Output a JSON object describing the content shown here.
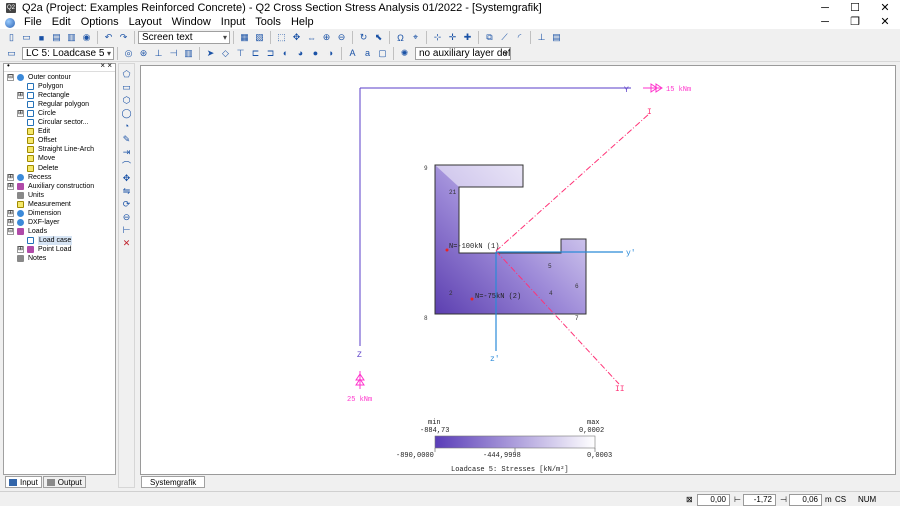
{
  "window": {
    "app_icon": "Q2",
    "title": "Q2a (Project: Examples Reinforced Concrete) - Q2 Cross Section Stress Analysis 01/2022 - [Systemgrafik]",
    "min_icon": "─",
    "max_icon": "☐",
    "close_icon": "✕"
  },
  "menu": {
    "items": [
      "File",
      "Edit",
      "Options",
      "Layout",
      "Window",
      "Input",
      "Tools",
      "Help"
    ],
    "right_min": "─",
    "right_restore": "❐",
    "right_close": "✕"
  },
  "toolbar": {
    "text_mode_value": "Screen text",
    "loadcase_value": "LC 5: Loadcase 5",
    "aux_layer_value": "no auxiliary layer defines"
  },
  "tree": {
    "header_left": "•",
    "header_right": "× ×",
    "items": [
      {
        "label": "Outer contour",
        "level": 0,
        "exp": "⊟",
        "icon": "bl"
      },
      {
        "label": "Polygon",
        "level": 1,
        "exp": "",
        "icon": "sq"
      },
      {
        "label": "Rectangle",
        "level": 1,
        "exp": "⊞",
        "icon": "sq"
      },
      {
        "label": "Regular polygon",
        "level": 1,
        "exp": "",
        "icon": "sq"
      },
      {
        "label": "Circle",
        "level": 1,
        "exp": "⊞",
        "icon": "sq"
      },
      {
        "label": "Circular sector...",
        "level": 1,
        "exp": "",
        "icon": "sq"
      },
      {
        "label": "Edit",
        "level": 1,
        "exp": "",
        "icon": "yl"
      },
      {
        "label": "Offset",
        "level": 1,
        "exp": "",
        "icon": "yl"
      },
      {
        "label": "Straight Line-Arch",
        "level": 1,
        "exp": "",
        "icon": "yl"
      },
      {
        "label": "Move",
        "level": 1,
        "exp": "",
        "icon": "yl"
      },
      {
        "label": "Delete",
        "level": 1,
        "exp": "",
        "icon": "yl"
      },
      {
        "label": "Recess",
        "level": 0,
        "exp": "⊞",
        "icon": "bl"
      },
      {
        "label": "Auxiliary construction",
        "level": 0,
        "exp": "⊞",
        "icon": "mg"
      },
      {
        "label": "Units",
        "level": 0,
        "exp": "",
        "icon": "gr"
      },
      {
        "label": "Measurement",
        "level": 0,
        "exp": "",
        "icon": "yl"
      },
      {
        "label": "Dimension",
        "level": 0,
        "exp": "⊞",
        "icon": "bl"
      },
      {
        "label": "DXF-layer",
        "level": 0,
        "exp": "⊞",
        "icon": "bl"
      },
      {
        "label": "Loads",
        "level": 0,
        "exp": "⊟",
        "icon": "mg"
      },
      {
        "label": "Load case",
        "level": 1,
        "exp": "",
        "icon": "sq",
        "selected": true
      },
      {
        "label": "Point Load",
        "level": 1,
        "exp": "⊞",
        "icon": "mg"
      },
      {
        "label": "Notes",
        "level": 0,
        "exp": "",
        "icon": "gr"
      }
    ]
  },
  "bottom_tabs": {
    "input": "Input",
    "output": "Output",
    "graphic": "Systemgrafik"
  },
  "status": {
    "field1": "0,00",
    "field2": "-1,72",
    "field3": "0,06",
    "unit": "m",
    "cs": "CS",
    "num": "NUM"
  },
  "graphic": {
    "axis_y": "Y",
    "axis_z": "Z",
    "axis_y2": "y'",
    "axis_z2": "z'",
    "axis_I": "I",
    "axis_II": "II",
    "moment_y": "15 kNm",
    "moment_z": "25 kNm",
    "load_1": "N=-100kN (1)",
    "load_2": "N=-75kN (2)",
    "nodes": [
      "9",
      "21",
      "8",
      "2",
      "4",
      "5",
      "6",
      "7"
    ],
    "legend_min_label": "min",
    "legend_max_label": "max",
    "legend_min_value": "-884,73",
    "legend_max_value": "0,0002",
    "legend_tick_left": "-890,0000",
    "legend_tick_mid": "-444,9998",
    "legend_tick_right": "0,0003",
    "legend_title": "Loadcase 5: Stresses [kN/m²]",
    "colors": {
      "axis": "#5a3dc8",
      "principal": "#ff3377",
      "centroid": "#2a8ad8",
      "stress_dark": "#6a50b8",
      "stress_light": "#e8e4f6"
    }
  }
}
